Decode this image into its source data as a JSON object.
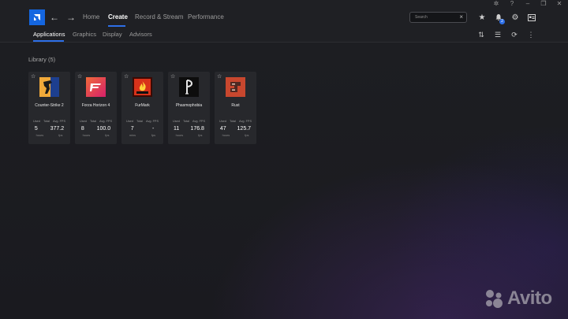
{
  "window_controls": [
    {
      "icon": "bug-icon",
      "glyph": "✲"
    },
    {
      "icon": "help-icon",
      "glyph": "?"
    },
    {
      "icon": "minimize-icon",
      "glyph": "–"
    },
    {
      "icon": "restore-icon",
      "glyph": "❐"
    },
    {
      "icon": "close-icon",
      "glyph": "✕"
    }
  ],
  "topnav": {
    "back_icon": "arrow-left-icon",
    "forward_icon": "arrow-right-icon",
    "links": [
      "Home",
      "Create",
      "Record & Stream",
      "Performance"
    ],
    "active": "Create",
    "search_placeholder": "Search",
    "notification_count": "2",
    "icons": [
      "star-icon",
      "bell-icon",
      "gear-icon",
      "account-icon"
    ]
  },
  "subnav": {
    "tabs": [
      "Applications",
      "Graphics",
      "Display",
      "Advisors"
    ],
    "active": "Applications",
    "icons": [
      "sort-icon",
      "list-view-icon",
      "refresh-icon",
      "more-icon"
    ]
  },
  "library": {
    "title": "Library (5)",
    "label_used": "Used",
    "label_total": "Total",
    "label_avg": "Avg. FPS",
    "games": [
      {
        "name": "Counter-Strike 2",
        "total": "5",
        "unit_total": "hours",
        "avg_fps": "377.2",
        "unit_fps": "fps",
        "color": "#f0a93a"
      },
      {
        "name": "Forza Horizon 4",
        "total": "8",
        "unit_total": "hours",
        "avg_fps": "100.0",
        "unit_fps": "fps",
        "color": "#e2492f"
      },
      {
        "name": "FurMark",
        "total": "7",
        "unit_total": "mins",
        "avg_fps": "-",
        "unit_fps": "fps",
        "color": "#e23a1f"
      },
      {
        "name": "Phasmophobia",
        "total": "11",
        "unit_total": "hours",
        "avg_fps": "176.8",
        "unit_fps": "fps",
        "color": "#111111"
      },
      {
        "name": "Rust",
        "total": "47",
        "unit_total": "hours",
        "avg_fps": "125.7",
        "unit_fps": "fps",
        "color": "#c8472e"
      }
    ]
  },
  "watermark": "Avito",
  "accent_color": "#2d6fe8"
}
